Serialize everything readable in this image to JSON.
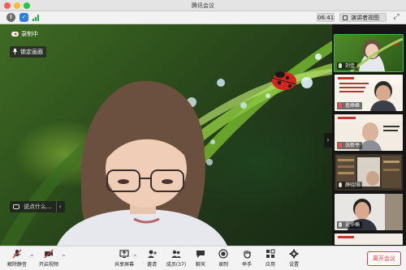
{
  "window": {
    "title": "腾讯会议"
  },
  "toolbar": {
    "icons": [
      "info-icon",
      "shield-icon",
      "signal-icon"
    ],
    "timer": "06:41",
    "view_label": "演讲者视图",
    "fullscreen_icon": "fullscreen-icon"
  },
  "main": {
    "recording_label": "录制中",
    "lock_label": "锁定画面",
    "chat_placeholder": "说点什么...",
    "expand_arrow": "›"
  },
  "participants": [
    {
      "name": "刘佳",
      "mic": "on",
      "active": true
    },
    {
      "name": "查峥峰",
      "mic": "muted"
    },
    {
      "name": "张新平",
      "mic": "muted"
    },
    {
      "name": "薛晓阳",
      "mic": "on"
    },
    {
      "name": "史华楠",
      "mic": "on"
    }
  ],
  "controls": {
    "mute": "解除静音",
    "video": "开启视频",
    "share": "共享屏幕",
    "invite": "邀请",
    "members": "成员(37)",
    "chat": "聊天",
    "record": "录制",
    "raise_hand": "举手",
    "apps": "应用",
    "settings": "设置",
    "leave": "离开会议"
  },
  "colors": {
    "accent_green": "#31c14a",
    "leave_red": "#e33b3b",
    "recording_red": "#e53935"
  }
}
